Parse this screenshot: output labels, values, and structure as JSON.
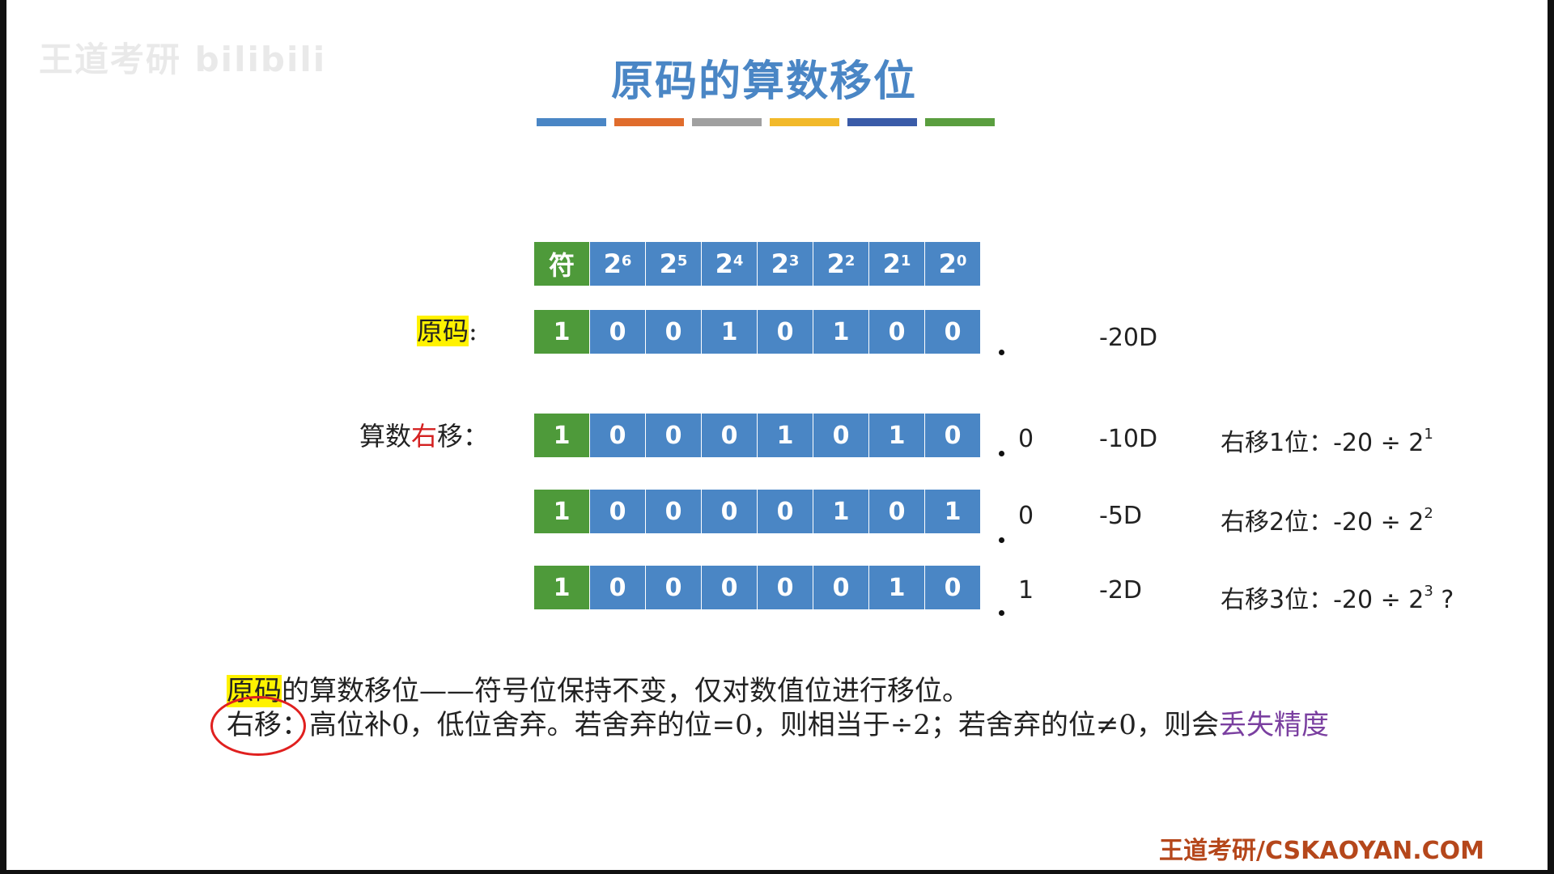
{
  "watermark": "王道考研 bilibili",
  "title": "原码的算数移位",
  "color_bars": [
    "#4a86c5",
    "#e06c2c",
    "#a0a0a0",
    "#f2b92a",
    "#3a5ba8",
    "#5a9e3f"
  ],
  "header_row": {
    "sign": "符",
    "powers": [
      {
        "base": "2",
        "exp": "6"
      },
      {
        "base": "2",
        "exp": "5"
      },
      {
        "base": "2",
        "exp": "4"
      },
      {
        "base": "2",
        "exp": "3"
      },
      {
        "base": "2",
        "exp": "2"
      },
      {
        "base": "2",
        "exp": "1"
      },
      {
        "base": "2",
        "exp": "0"
      }
    ]
  },
  "labels": {
    "original": "原码",
    "colon": ":",
    "shift_prefix": "算数",
    "shift_red": "右",
    "shift_suffix": "移："
  },
  "rows": [
    {
      "bits": [
        "1",
        "0",
        "0",
        "1",
        "0",
        "1",
        "0",
        "0"
      ],
      "shifted_out": "",
      "decimal": "-20D",
      "desc_prefix": "",
      "exp": "",
      "desc_suffix": ""
    },
    {
      "bits": [
        "1",
        "0",
        "0",
        "0",
        "1",
        "0",
        "1",
        "0"
      ],
      "shifted_out": "0",
      "decimal": "-10D",
      "desc_prefix": "右移1位：-20 ÷ 2",
      "exp": "1",
      "desc_suffix": ""
    },
    {
      "bits": [
        "1",
        "0",
        "0",
        "0",
        "0",
        "1",
        "0",
        "1"
      ],
      "shifted_out": "0",
      "decimal": "-5D",
      "desc_prefix": "右移2位：-20 ÷ 2",
      "exp": "2",
      "desc_suffix": ""
    },
    {
      "bits": [
        "1",
        "0",
        "0",
        "0",
        "0",
        "0",
        "1",
        "0"
      ],
      "shifted_out": "1",
      "decimal": "-2D",
      "desc_prefix": "右移3位：-20 ÷ 2",
      "exp": "3",
      "desc_suffix": " ?"
    }
  ],
  "notes": {
    "line1_hl": "原码",
    "line1_rest": "的算数移位——符号位保持不变，仅对数值位进行移位。",
    "line2_label": "右移：",
    "line2_text": "高位补0，低位舍弃。若舍弃的位=0，则相当于÷2；若舍弃的位≠0，则会",
    "line2_purple": "丢失精度"
  },
  "footer": "王道考研/CSKAOYAN.COM"
}
